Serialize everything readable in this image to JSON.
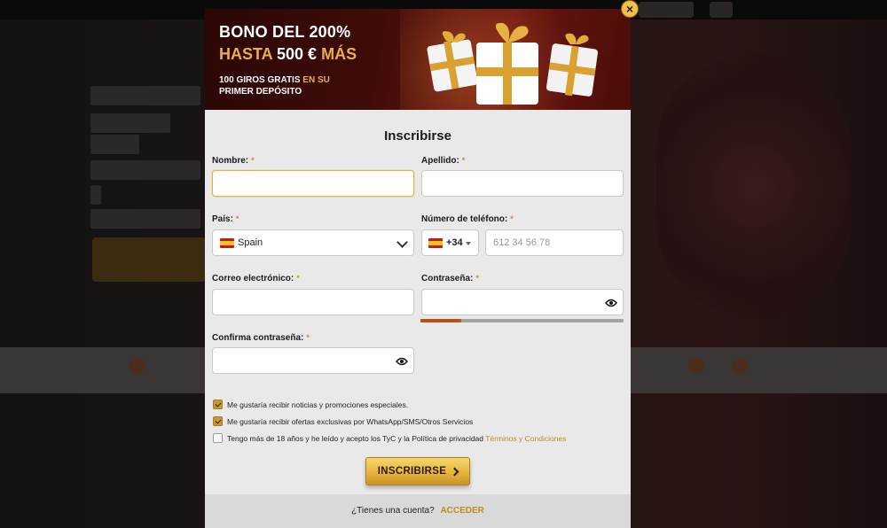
{
  "banner": {
    "title_line1": "BONO DEL 200%",
    "title_line2_gold": "HASTA",
    "title_line2_white": "500 €",
    "title_line2_gold2": "MÁS",
    "sub_white": "100 GIROS GRATIS",
    "sub_gold": "EN SU",
    "sub_white2": "PRIMER DEPÓSITO"
  },
  "modal": {
    "close_icon": "×",
    "title": "Inscribirse"
  },
  "form": {
    "required_mark": "*",
    "nombre_label": "Nombre:",
    "apellido_label": "Apellido:",
    "pais_label": "País:",
    "pais_value": "Spain",
    "telefono_label": "Número de teléfono:",
    "telefono_code": "+34",
    "telefono_placeholder": "612 34 56 78",
    "correo_label": "Correo electrónico:",
    "contrasena_label": "Contraseña:",
    "confirma_label": "Confirma contraseña:",
    "password_strength": 0.2
  },
  "checkboxes": [
    {
      "text": "Me gustaría recibir noticias y promociones especiales.",
      "checked": true
    },
    {
      "text": "Me gustaría recibir ofertas exclusivas por WhatsApp/SMS/Otros Servicios",
      "checked": true
    },
    {
      "text": "Tengo más de 18 años y he leído y acepto los TyC y la Política de privacidad",
      "link": "Términos y Condiciones",
      "checked": false
    }
  ],
  "cta": {
    "label": "INSCRIBIRSE"
  },
  "footer": {
    "question": "¿Tienes una cuenta?",
    "link": "ACCEDER"
  },
  "colors": {
    "accent_gold": "#e8b04a",
    "banner_red": "#3f0c09",
    "strength_fill": "#b4541a"
  },
  "icons": {
    "close": "close-icon",
    "eye": "eye-icon",
    "chevron": "chevron-down-icon",
    "flag": "spain-flag-icon",
    "gift": "gift-icon"
  }
}
